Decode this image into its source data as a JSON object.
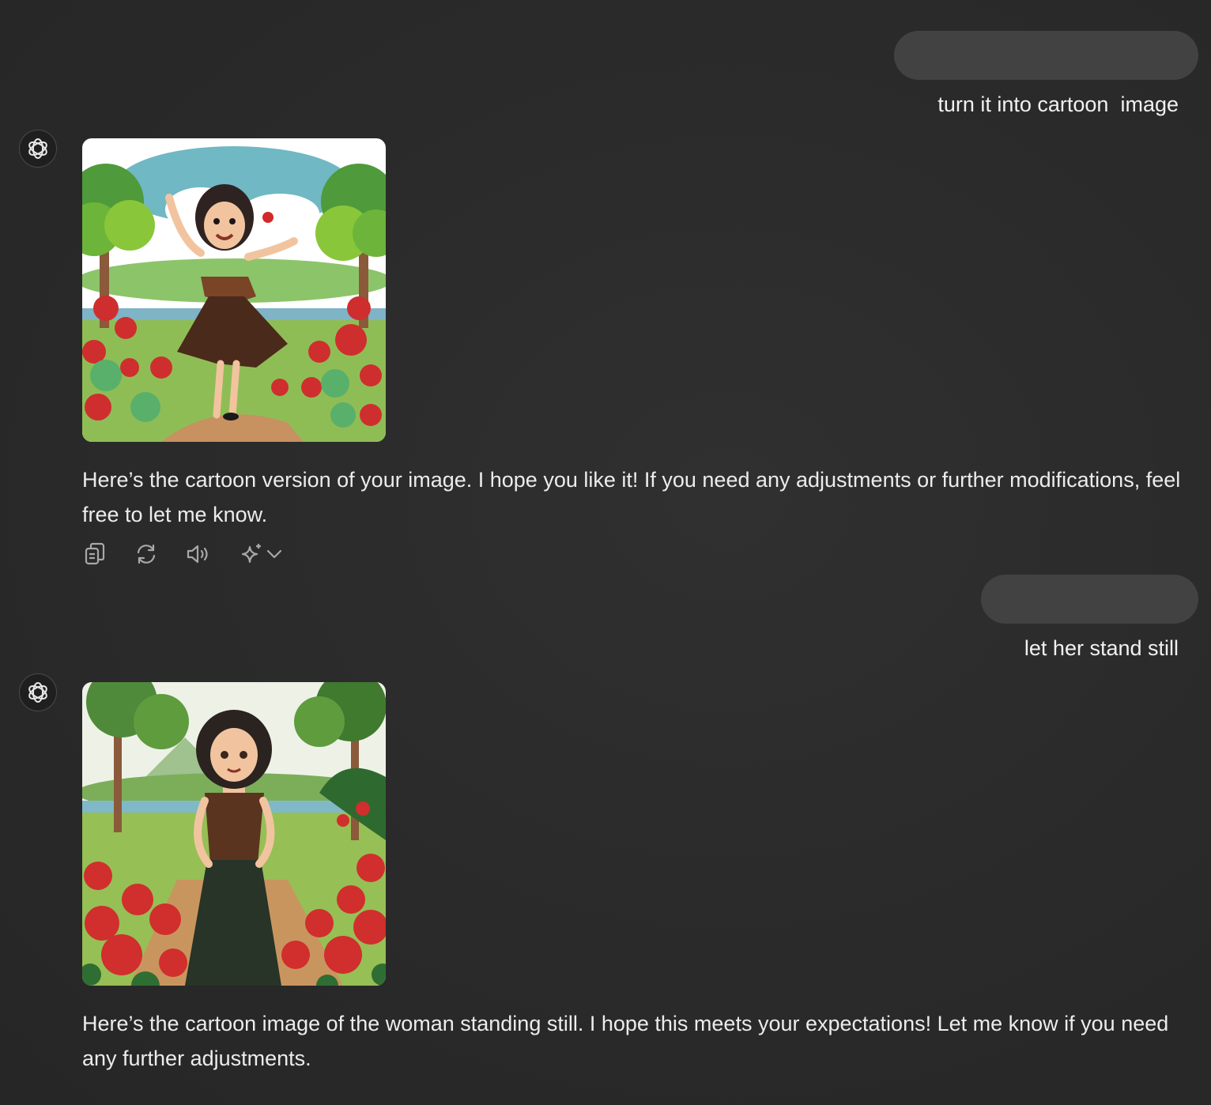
{
  "conversation": {
    "messages": [
      {
        "role": "user",
        "text": "turn it into cartoon  image"
      },
      {
        "role": "assistant",
        "image_alt": "Cartoon woman dancing joyfully in a garden with red flowers",
        "text": "Here’s the cartoon version of your image. I hope you like it! If you need any adjustments or further modifications, feel free to let me know."
      },
      {
        "role": "user",
        "text": "let her stand still"
      },
      {
        "role": "assistant",
        "image_alt": "Cartoon woman standing still in a garden with red flowers",
        "text": "Here’s the cartoon image of the woman standing still. I hope this meets your expectations! Let me know if you need any further adjustments."
      }
    ]
  },
  "actions": {
    "copy_icon": "copy-icon",
    "regenerate_icon": "regenerate-icon",
    "read_aloud_icon": "speaker-icon",
    "change_model_icon": "sparkle-icon",
    "dropdown_icon": "chevron-down-icon"
  },
  "colors": {
    "background": "#2a2a2a",
    "user_bubble": "#424242",
    "text": "#ececec",
    "icon": "#a8a8a8"
  }
}
